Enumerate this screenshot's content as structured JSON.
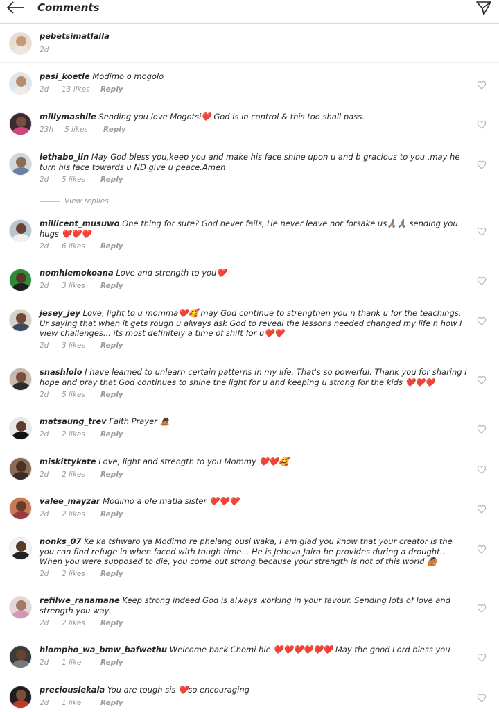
{
  "header": {
    "title": "Comments",
    "back_icon": "arrow-left-icon",
    "send_icon": "paper-plane-icon"
  },
  "caption": {
    "username": "pebetsimatlaila",
    "time": "2d"
  },
  "comments": [
    {
      "username": "pasi_koetle",
      "text": "Modimo o mogolo",
      "time": "2d",
      "likes": "13 likes",
      "reply": "Reply"
    },
    {
      "username": "millymashile",
      "text": "Sending you love Mogotsi❤️ God is in control & this too shall pass.",
      "time": "23h",
      "likes": "5 likes",
      "reply": "Reply"
    },
    {
      "username": "lethabo_lin",
      "text": "May God bless you,keep you and make his face shine upon u and b gracious to you ,may he turn his face towards u ND give u peace.Amen",
      "time": "2d",
      "likes": "5 likes",
      "reply": "Reply",
      "view_replies": "View replies"
    },
    {
      "username": "millicent_musuwo",
      "text": "One thing for sure? God never fails, He never leave nor forsake us🙏🏽🙏🏽.sending you hugs ❤️❤️❤️",
      "time": "2d",
      "likes": "6 likes",
      "reply": "Reply"
    },
    {
      "username": "nomhlemokoana",
      "text": "Love and strength to you❤️",
      "time": "2d",
      "likes": "3 likes",
      "reply": "Reply"
    },
    {
      "username": "jesey_jey",
      "text": "Love, light to u momma❤️🥰 may God continue to strengthen you n thank u for the teachings. Ur saying that when it gets rough u always ask God to reveal the lessons needed changed my life n how I view challenges... its most definitely a time of shift for u❤️❤️",
      "time": "2d",
      "likes": "3 likes",
      "reply": "Reply"
    },
    {
      "username": "snashlolo",
      "text": "I have learned to unlearn certain patterns in my life. That's so powerful. Thank you for sharing I hope and pray that God continues to shine the light for u and keeping u strong for the kids ❤️❤️❤️",
      "time": "2d",
      "likes": "5 likes",
      "reply": "Reply"
    },
    {
      "username": "matsaung_trev",
      "text": "Faith Prayer 🙇🏽",
      "time": "2d",
      "likes": "2 likes",
      "reply": "Reply"
    },
    {
      "username": "miskittykate",
      "text": "Love, light and strength to you Mommy ❤️❤️🥰",
      "time": "2d",
      "likes": "2 likes",
      "reply": "Reply"
    },
    {
      "username": "valee_mayzar",
      "text": "Modimo a ofe matla sister ❤️❤️❤️",
      "time": "2d",
      "likes": "2 likes",
      "reply": "Reply"
    },
    {
      "username": "nonks_07",
      "text": "Ke ka tshwaro ya Modimo re phelang ousi waka, I am glad you know that your creator is the you can find refuge in when faced with tough time... He is Jehova Jaira he provides during a drought... When you were supposed to die, you come out strong because your strength is not of this world 🙆🏽",
      "time": "2d",
      "likes": "2 likes",
      "reply": "Reply"
    },
    {
      "username": "refilwe_ranamane",
      "text": "Keep strong indeed God is always working in your favour. Sending lots of love and strength you way.",
      "time": "2d",
      "likes": "2 likes",
      "reply": "Reply"
    },
    {
      "username": "hlompho_wa_bmw_bafwethu",
      "text": "Welcome back Chomi hle ❤️❤️❤️❤️❤️❤️ May the good Lord bless you",
      "time": "2d",
      "likes": "1 like",
      "reply": "Reply"
    },
    {
      "username": "preciouslekala",
      "text": "You are tough sis ❤️so encouraging",
      "time": "2d",
      "likes": "1 like",
      "reply": "Reply"
    }
  ],
  "icons": {
    "like": "heart-outline-icon"
  },
  "colors": {
    "text": "#262626",
    "meta": "#9a9a9a",
    "divider": "#dbdbdb",
    "heart": "#e41e3f"
  }
}
